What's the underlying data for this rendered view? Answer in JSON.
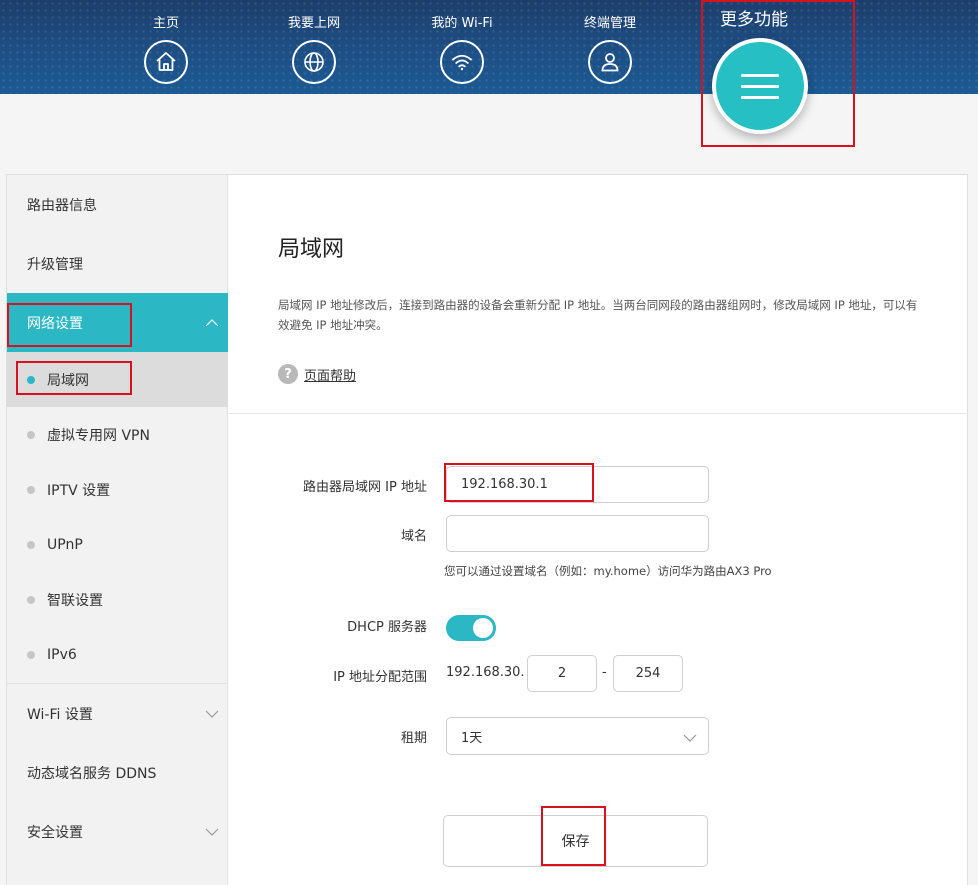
{
  "nav": {
    "items": [
      {
        "label": "主页",
        "icon": "home-icon"
      },
      {
        "label": "我要上网",
        "icon": "globe-icon"
      },
      {
        "label": "我的 Wi-Fi",
        "icon": "wifi-icon"
      },
      {
        "label": "终端管理",
        "icon": "user-icon"
      }
    ],
    "more_label": "更多功能",
    "more_icon": "menu-icon"
  },
  "sidebar": {
    "router_info": "路由器信息",
    "upgrade": "升级管理",
    "network": "网络设置",
    "network_sub": [
      "局域网",
      "虚拟专用网 VPN",
      "IPTV 设置",
      "UPnP",
      "智联设置",
      "IPv6"
    ],
    "wifi": "Wi-Fi 设置",
    "ddns": "动态域名服务 DDNS",
    "security": "安全设置"
  },
  "main": {
    "title": "局域网",
    "description": "局域网 IP 地址修改后，连接到路由器的设备会重新分配 IP 地址。当两台同网段的路由器组网时，修改局域网 IP 地址，可以有效避免 IP 地址冲突。",
    "help": "页面帮助",
    "form": {
      "ip_label": "路由器局域网 IP 地址",
      "ip_value": "192.168.30.1",
      "domain_label": "域名",
      "domain_value": "",
      "domain_hint": "您可以通过设置域名（例如：my.home）访问华为路由AX3 Pro",
      "dhcp_label": "DHCP 服务器",
      "dhcp_enabled": true,
      "range_label": "IP 地址分配范围",
      "range_prefix": "192.168.30.",
      "range_start": "2",
      "range_sep": "-",
      "range_end": "254",
      "lease_label": "租期",
      "lease_value": "1天",
      "save": "保存"
    }
  },
  "colors": {
    "header": "#1d4f84",
    "accent": "#2bb7c3",
    "highlight_box": "#d9111c"
  }
}
